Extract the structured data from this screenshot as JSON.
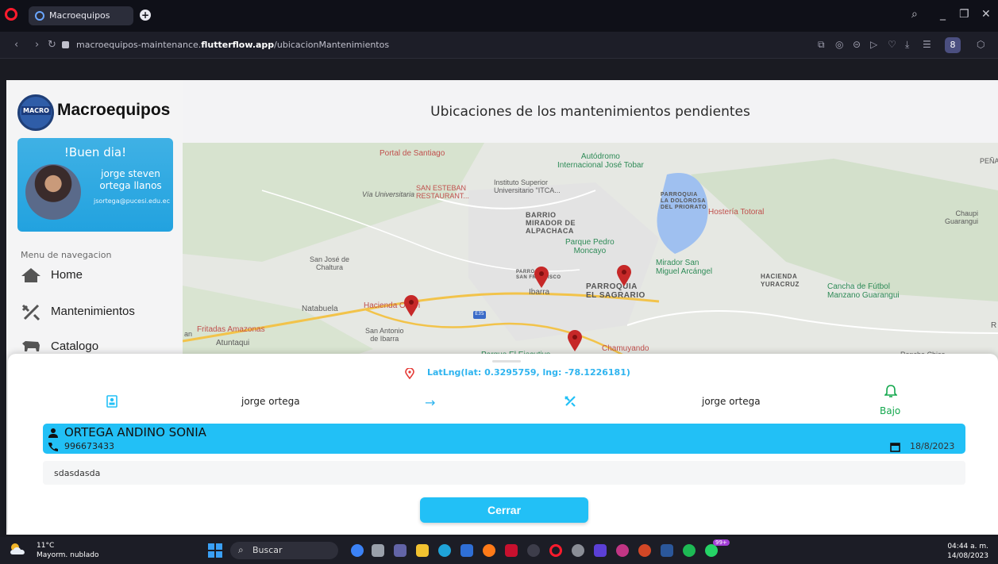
{
  "browser": {
    "tab_title": "Macroequipos",
    "url_prefix": "macroequipos-maintenance.",
    "url_domain": "flutterflow.app",
    "url_path": "/ubicacionMantenimientos"
  },
  "sidebar": {
    "brand_logo_text": "MACRO",
    "brand_name": "Macroequipos",
    "greeting": "!Buen dia!",
    "user_name": "jorge steven ortega llanos",
    "user_email": "jsortega@pucesi.edu.ec",
    "menu_label": "Menu de navegacion",
    "items": [
      {
        "label": "Home",
        "icon": "home-icon"
      },
      {
        "label": "Mantenimientos",
        "icon": "tools-icon"
      },
      {
        "label": "Catalogo",
        "icon": "cow-icon"
      }
    ]
  },
  "main": {
    "title": "Ubicaciones de los mantenimientos pendientes"
  },
  "map": {
    "labels": {
      "portal": "Portal de Santiago",
      "autodromo": "Autódromo\nInternacional José Tobar",
      "instituto": "Instituto Superior\nUniversitario \"ITCA...",
      "san_esteban": "SAN ESTEBAN\nRESTAURANT...",
      "via": "Vía Universitaria",
      "barrio": "BARRIO\nMIRADOR DE\nALPACHACA",
      "parroquia_dolorosa": "PARROQUIA\nLA DOLOROSA\nDEL PRIORATO",
      "hosteria": "Hostería Totoral",
      "chaupi": "Chaupi\nGuarangui",
      "pena": "PEÑA",
      "parque": "Parque Pedro\nMoncayo",
      "mirador": "Mirador San\nMiguel Arcángel",
      "hacienda_y": "HACIENDA\nYURACRUZ",
      "cancha": "Cancha de Fútbol\nManzano Guarangui",
      "san_jose": "San José de\nChaltura",
      "sanfrancisco": "PARROQUIA\nSAN FRANCISCO",
      "ibarra": "Ibarra",
      "el_sagrario": "PARROQUIA\nEL SAGRARIO",
      "natabuela": "Natabuela",
      "hacienda_rlavi": "Hacienda Orlavi",
      "fritadas": "Fritadas Amazonas",
      "an": "an",
      "san_antonio": "San Antonio\nde Ibarra",
      "atuntaqui": "Atuntaqui",
      "chamuyando": "Chamuyando",
      "parque_bottom": "Parque El Ejecutivo",
      "rancho": "Rancho Chico",
      "r": "R",
      "shield": "E35"
    }
  },
  "sheet": {
    "coords": "LatLng(lat: 0.3295759, lng: -78.1226181)",
    "from_user": "jorge ortega",
    "arrow": "→",
    "to_user": "jorge ortega",
    "priority": "Bajo",
    "client_name": "ORTEGA ANDINO SONIA",
    "client_phone": "996673433",
    "date": "18/8/2023",
    "notes": "sdasdasda",
    "close_label": "Cerrar"
  },
  "taskbar": {
    "temp": "11°C",
    "weather": "Mayorm. nublado",
    "search_label": "Buscar",
    "time": "04:44 a. m.",
    "date": "14/08/2023",
    "badge": "99+"
  },
  "colors": {
    "accent": "#22c0f6",
    "green": "#14a84e",
    "marker": "#c62828"
  }
}
